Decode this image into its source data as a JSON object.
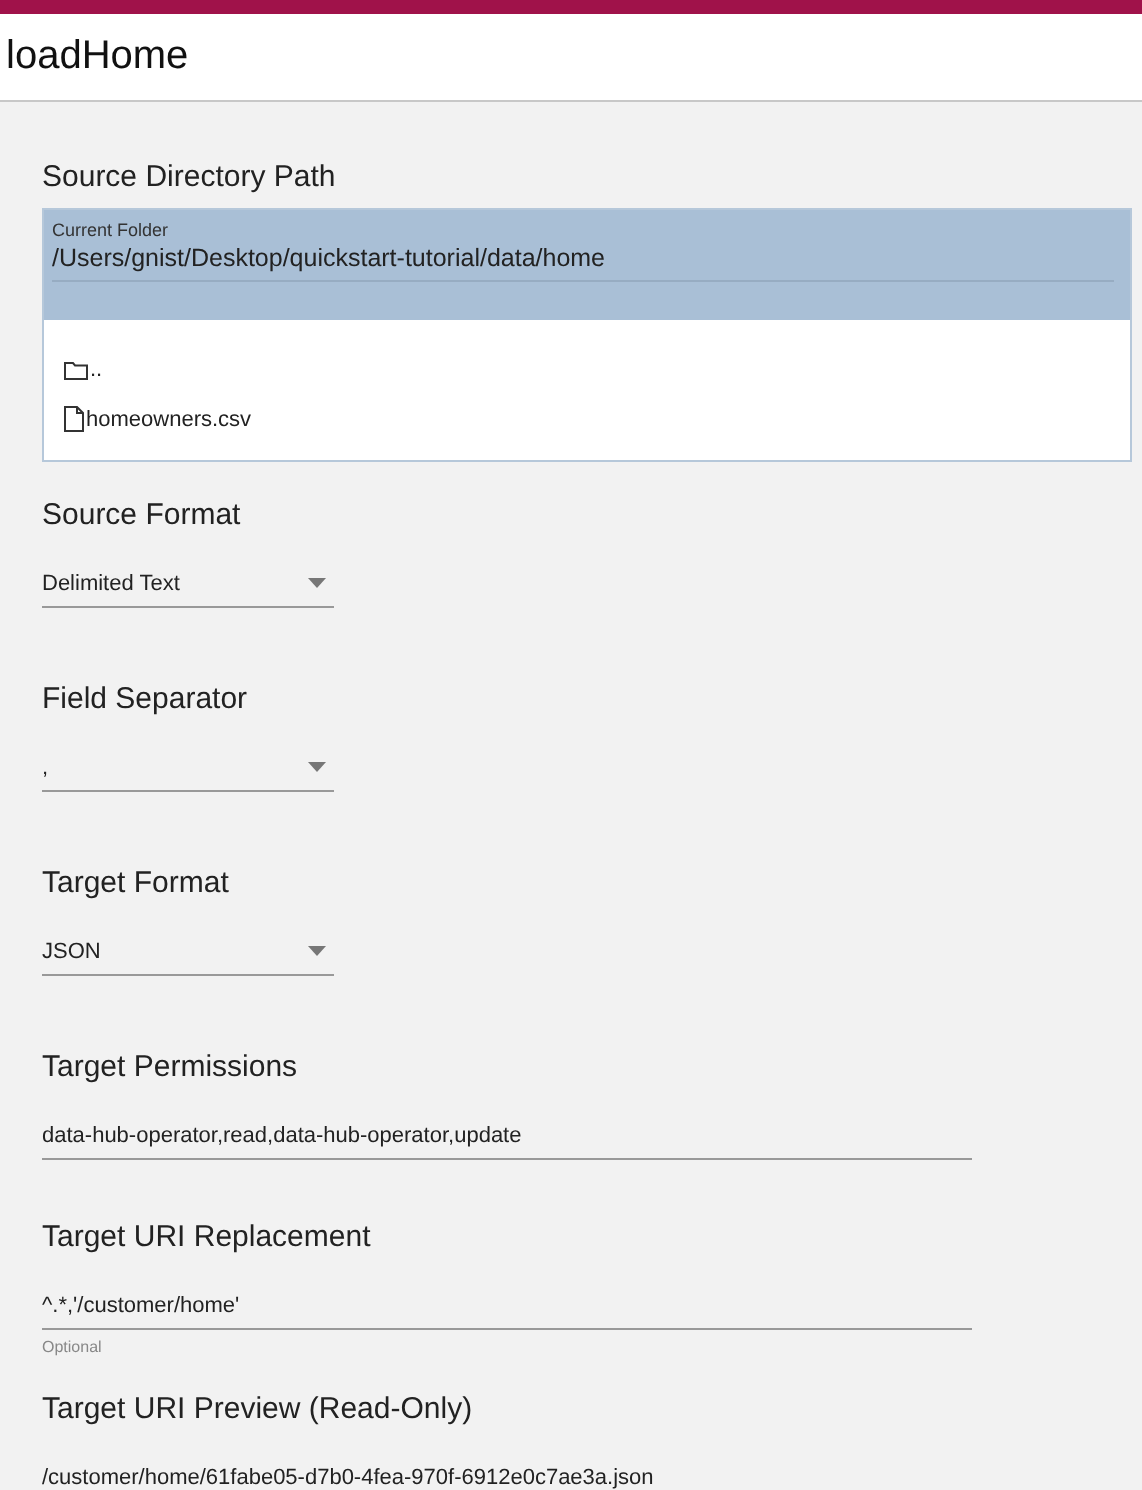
{
  "title": "loadHome",
  "source_directory": {
    "heading": "Source Directory Path",
    "current_label": "Current Folder",
    "current_path": "/Users/gnist/Desktop/quickstart-tutorial/data/home",
    "entries": [
      {
        "kind": "folder",
        "name": ".."
      },
      {
        "kind": "file",
        "name": "homeowners.csv"
      }
    ]
  },
  "fields": [
    {
      "kind": "select",
      "label": "Source Format",
      "value": "Delimited Text"
    },
    {
      "kind": "select",
      "label": "Field Separator",
      "value": ","
    },
    {
      "kind": "select",
      "label": "Target Format",
      "value": "JSON"
    },
    {
      "kind": "text",
      "label": "Target Permissions",
      "value": "data-hub-operator,read,data-hub-operator,update"
    },
    {
      "kind": "text",
      "label": "Target URI Replacement",
      "value": "^.*,'/customer/home'",
      "hint": "Optional"
    },
    {
      "kind": "text",
      "label": "Target URI Preview (Read-Only)",
      "value": "/customer/home/61fabe05-d7b0-4fea-970f-6912e0c7ae3a.json"
    }
  ]
}
